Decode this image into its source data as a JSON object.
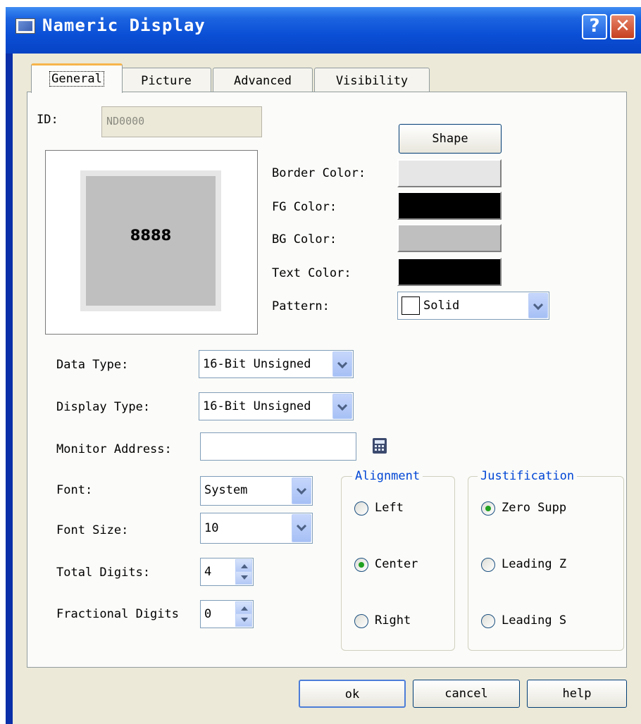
{
  "window": {
    "title": "Nameric Display",
    "help_glyph": "?",
    "close_glyph": "✕"
  },
  "tabs": [
    {
      "label": "General",
      "active": true
    },
    {
      "label": "Picture",
      "active": false
    },
    {
      "label": "Advanced",
      "active": false
    },
    {
      "label": "Visibility",
      "active": false
    }
  ],
  "general": {
    "id_label": "ID:",
    "id_value": "ND0000",
    "shape_button": "Shape",
    "preview_value": "8888",
    "colors": {
      "border_label": "Border Color:",
      "border_value": "#e6e6e6",
      "fg_label": "FG Color:",
      "fg_value": "#000000",
      "bg_label": "BG Color:",
      "bg_value": "#bfbfbf",
      "text_label": "Text Color:",
      "text_value": "#000000"
    },
    "pattern_label": "Pattern:",
    "pattern_value": "Solid",
    "data_type_label": "Data Type:",
    "data_type_value": "16-Bit Unsigned",
    "display_type_label": "Display Type:",
    "display_type_value": "16-Bit Unsigned",
    "monitor_address_label": "Monitor Address:",
    "monitor_address_value": "",
    "font_label": "Font:",
    "font_value": "System",
    "font_size_label": "Font Size:",
    "font_size_value": "10",
    "total_digits_label": "Total Digits:",
    "total_digits_value": "4",
    "fractional_digits_label": "Fractional Digits",
    "fractional_digits_value": "0",
    "alignment": {
      "title": "Alignment",
      "options": [
        "Left",
        "Center",
        "Right"
      ],
      "selected": "Center"
    },
    "justification": {
      "title": "Justification",
      "options": [
        "Zero Supp",
        "Leading Z",
        "Leading S"
      ],
      "selected": "Zero Supp"
    }
  },
  "buttons": {
    "ok": "ok",
    "cancel": "cancel",
    "help": "help"
  }
}
